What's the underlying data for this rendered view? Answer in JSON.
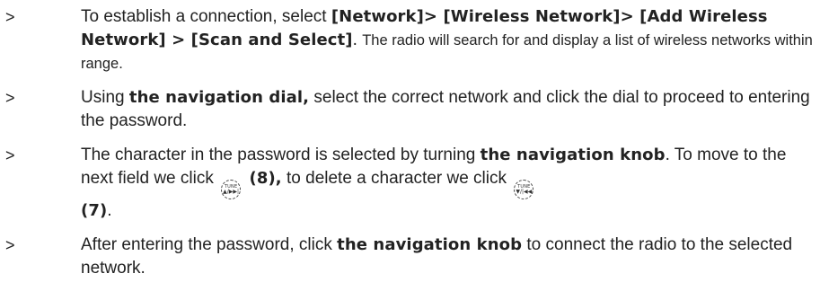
{
  "items": [
    {
      "marker": ">",
      "p1": "To establish a connection, select ",
      "b1": "[Network]> [Wireless Network]> [Add Wireless Network] > [Scan and Select]",
      "p2": ". ",
      "small": "The radio will search for and display a list of wireless networks within range."
    },
    {
      "marker": ">",
      "p1": "Using ",
      "b1": "the navigation dial,",
      "p2": " select the correct network and click the dial to proceed to entering the password."
    },
    {
      "marker": ">",
      "p1": "The character in the password is selected by turning ",
      "b1": "the navigation knob",
      "p2": ". To move to the next field we click ",
      "icon1_top": "TUNE",
      "icon1_bot": "▲/▶▶|",
      "b2": " (8),",
      "p3": " to delete a character we click ",
      "icon2_top": "TUNE",
      "icon2_bot": "▼/|◀◀",
      "b3": "(7)",
      "p4": "."
    },
    {
      "marker": ">",
      "p1": "After entering the password, click ",
      "b1": "the navigation knob",
      "p2": " to connect the radio to the selected network."
    }
  ],
  "icons": {
    "next_field_icon": "tune-forward-button-icon",
    "delete_icon": "tune-back-button-icon"
  }
}
